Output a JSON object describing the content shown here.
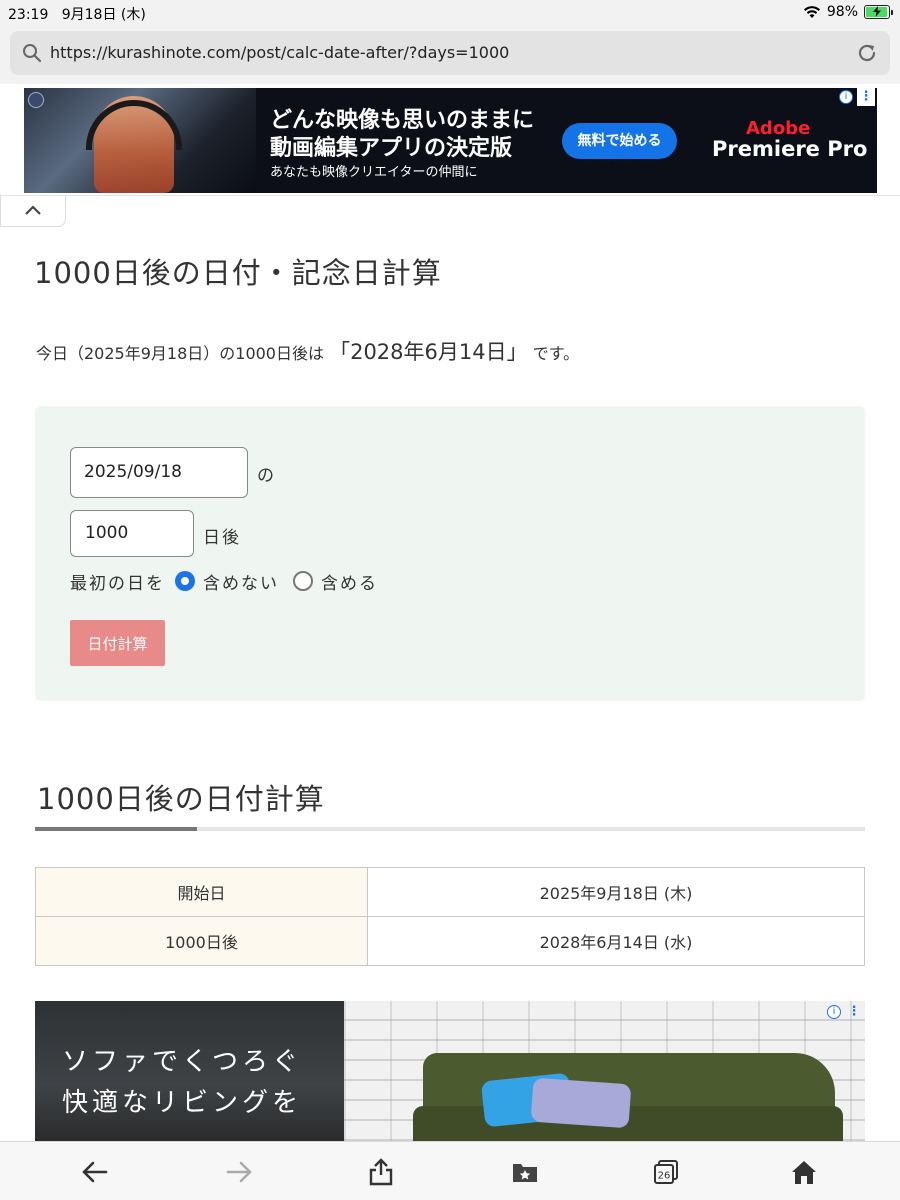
{
  "status": {
    "time": "23:19",
    "date": "9月18日 (木)",
    "battery_text": "98%",
    "battery_level": 0.98
  },
  "browser": {
    "url": "https://kurashinote.com/post/calc-date-after/?days=1000",
    "toolbar_tab_count": "26"
  },
  "ad_top": {
    "line1": "どんな映像も思いのままに",
    "line2": "動画編集アプリの決定版",
    "line3": "あなたも映像クリエイターの仲間に",
    "cta": "無料で始める",
    "brand_line1": "Adobe",
    "brand_line2": "Premiere Pro",
    "info_glyph": "i",
    "menu_glyph": "⋮"
  },
  "page": {
    "title": "1000日後の日付・記念日計算",
    "summary_prefix": "今日（2025年9月18日）の1000日後は",
    "summary_result": "「2028年6月14日」",
    "summary_suffix": "です。"
  },
  "calculator": {
    "date_value": "2025/09/18",
    "date_suffix": "の",
    "days_value": "1000",
    "days_suffix": "日後",
    "first_day_label": "最初の日を",
    "option_exclude": "含めない",
    "option_include": "含める",
    "selected_option": "exclude",
    "button_label": "日付計算"
  },
  "section": {
    "title": "1000日後の日付計算"
  },
  "result_table": {
    "rows": [
      {
        "label": "開始日",
        "value": "2025年9月18日 (木)"
      },
      {
        "label": "1000日後",
        "value": "2028年6月14日 (水)"
      }
    ]
  },
  "ad_bottom": {
    "line1": "ソファでくつろぐ",
    "line2": "快適なリビングを",
    "info_glyph": "i",
    "menu_glyph": "⋮"
  },
  "colors": {
    "accent_blue": "#1a73e8",
    "calc_button": "#e88a8a",
    "calc_bg": "#eff5f1",
    "table_header_bg": "#fdf9ee",
    "adobe_red": "#ff1f2f"
  },
  "icons": {
    "url_left": "search-icon",
    "url_right": "reload-icon",
    "collapse": "chevron-up-icon",
    "toolbar": [
      "back-arrow-icon",
      "forward-arrow-icon",
      "share-icon",
      "bookmarks-icon",
      "tabs-icon",
      "home-icon"
    ]
  }
}
